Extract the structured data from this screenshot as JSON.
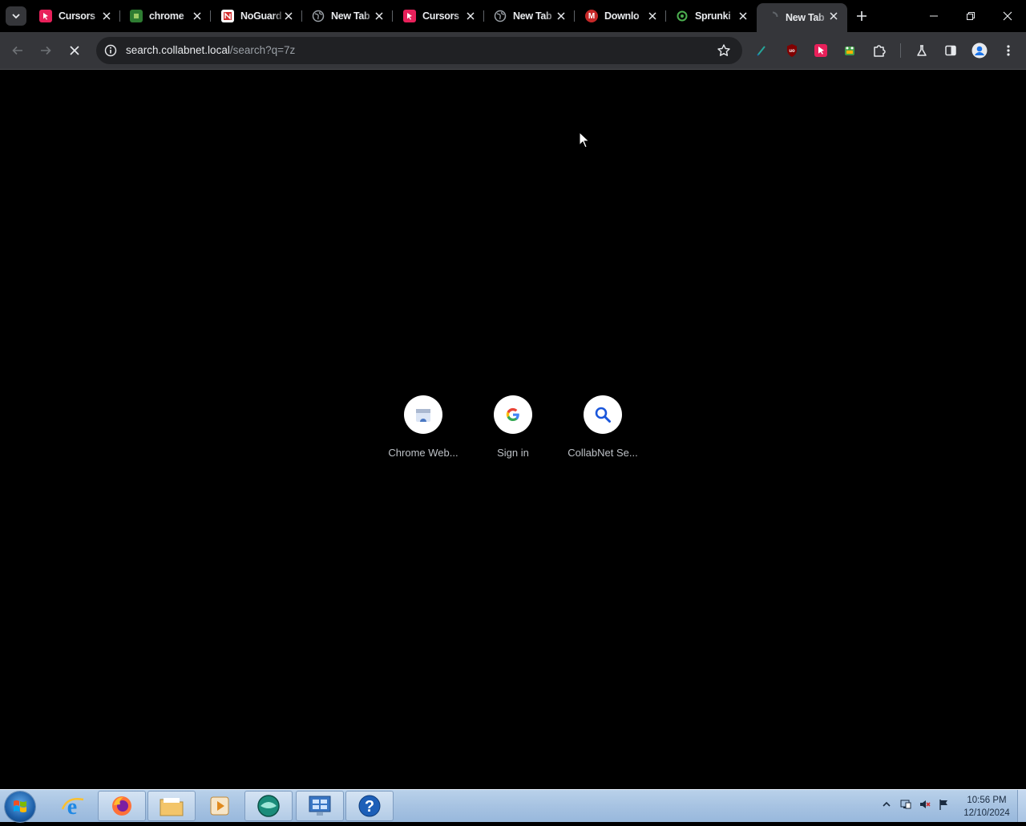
{
  "browser": {
    "tabs": [
      {
        "title": "Cursors",
        "favicon": "cursor-favicon",
        "color": "#e8205a"
      },
      {
        "title": "chrome",
        "favicon": "puzzle-favicon",
        "color": "#2e7d32"
      },
      {
        "title": "NoGuard",
        "favicon": "noguard-favicon",
        "color": "#d32f2f"
      },
      {
        "title": "New Tab",
        "favicon": "globe-favicon",
        "color": "#5f6368"
      },
      {
        "title": "Cursors",
        "favicon": "cursor-favicon",
        "color": "#e8205a"
      },
      {
        "title": "New Tab",
        "favicon": "globe-favicon",
        "color": "#5f6368"
      },
      {
        "title": "Downlo",
        "favicon": "m-favicon",
        "color": "#c62828"
      },
      {
        "title": "Sprunki",
        "favicon": "sprunki-favicon",
        "color": "#2e7d32"
      },
      {
        "title": "New Tab",
        "favicon": "loading-favicon",
        "color": "#5f6368"
      }
    ],
    "address": {
      "host": "search.collabnet.local",
      "path": "/search?q=7z"
    }
  },
  "shortcuts": [
    {
      "label": "Chrome Web...",
      "icon": "chrome-web-store-icon"
    },
    {
      "label": "Sign in",
      "icon": "google-icon"
    },
    {
      "label": "CollabNet Se...",
      "icon": "search-icon"
    }
  ],
  "taskbar": {
    "apps": [
      "internet-explorer-icon",
      "firefox-icon",
      "file-explorer-icon",
      "media-player-icon",
      "chat-icon",
      "control-panel-icon",
      "help-icon"
    ],
    "clock_time": "10:56 PM",
    "clock_date": "12/10/2024"
  },
  "colors": {
    "page_bg": "#000000",
    "toolbar_bg": "#35363a",
    "omnibox_bg": "#202124",
    "taskbar_bg": "#a7c3e2"
  }
}
